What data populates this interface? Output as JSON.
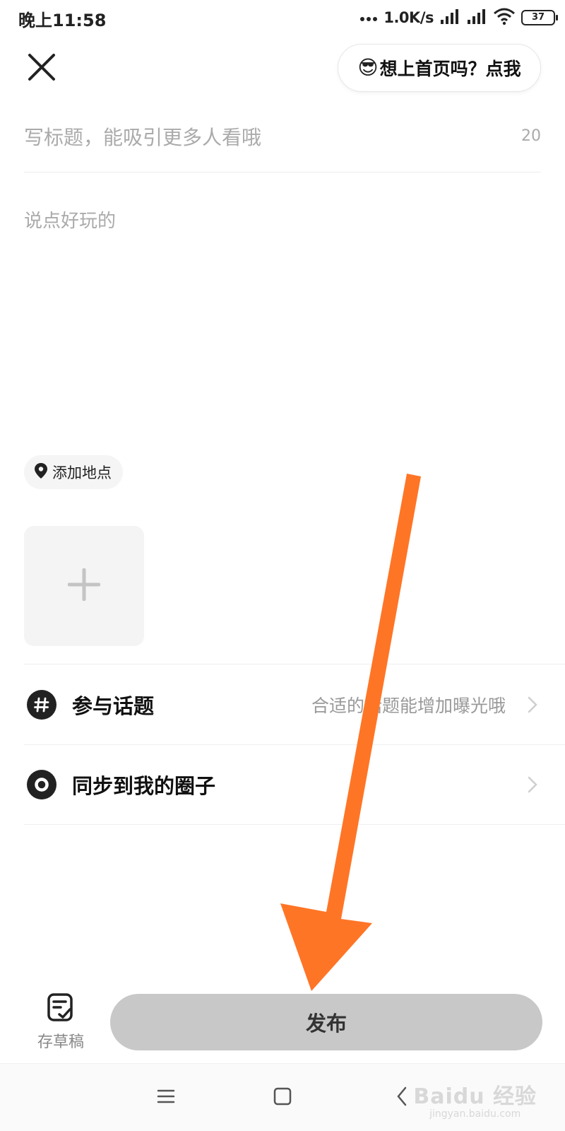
{
  "status_bar": {
    "time": "晚上11:58",
    "net_speed": "1.0K/s",
    "network_badge": "HD",
    "battery": "37",
    "icons": [
      "dots-icon",
      "signal-icon",
      "wifi-icon",
      "battery-icon"
    ]
  },
  "header": {
    "close_icon": "close-icon",
    "promo_emoji": "😎",
    "promo_text": "想上首页吗？点我"
  },
  "editor": {
    "title_placeholder": "写标题，能吸引更多人看哦",
    "title_value": "",
    "title_counter": "20",
    "body_placeholder": "说点好玩的",
    "body_value": ""
  },
  "location": {
    "icon": "location-pin-icon",
    "label": "添加地点"
  },
  "media": {
    "add_icon": "plus-icon"
  },
  "rows": {
    "topic": {
      "icon": "hashtag-icon",
      "title": "参与话题",
      "hint": "合适的话题能增加曝光哦"
    },
    "circle": {
      "icon": "circle-icon",
      "title": "同步到我的圈子"
    }
  },
  "bottom_bar": {
    "draft_icon": "draft-icon",
    "draft_label": "存草稿",
    "publish_label": "发布"
  },
  "colors": {
    "arrow": "#ff7526",
    "publish_bg": "#c8c8c8"
  },
  "watermark": {
    "main": "Baidu 经验",
    "sub": "jingyan.baidu.com"
  }
}
